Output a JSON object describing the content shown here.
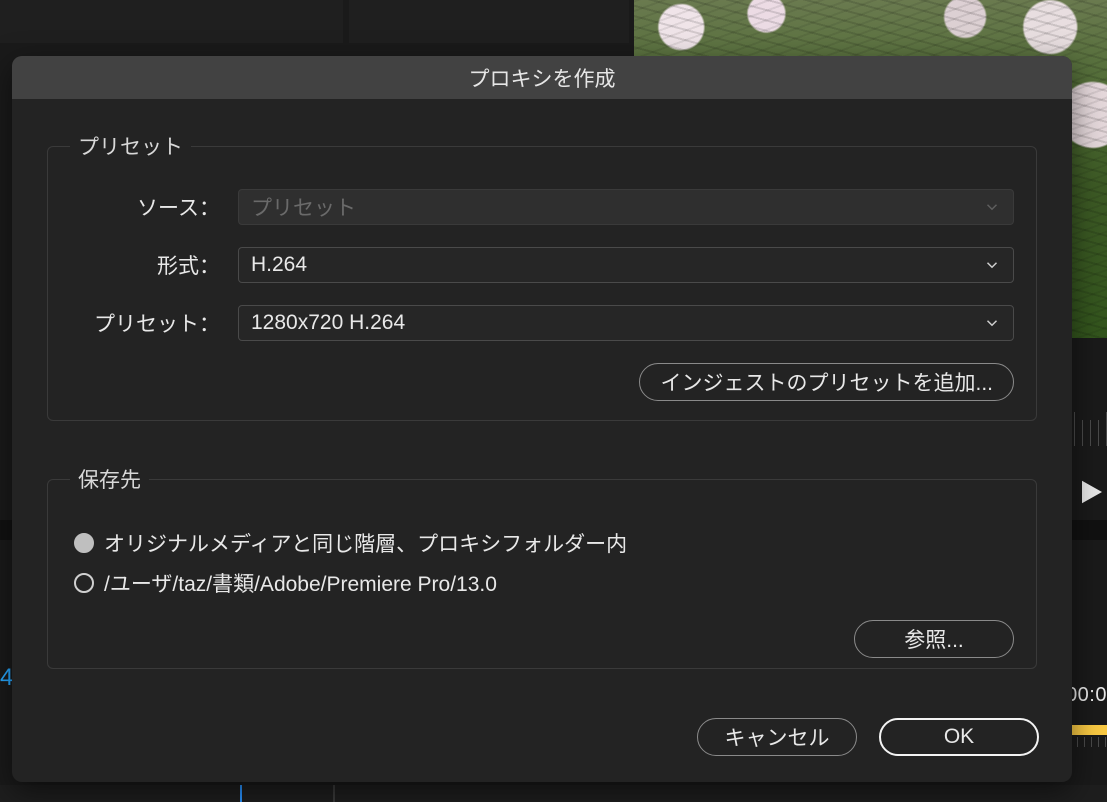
{
  "bg": {
    "clip_label": "4",
    "timecode": "00:0"
  },
  "dialog": {
    "title": "プロキシを作成",
    "preset_group": {
      "legend": "プリセット",
      "source_label": "ソース：",
      "source_value": "プリセット",
      "format_label": "形式：",
      "format_value": "H.264",
      "preset_label": "プリセット：",
      "preset_value": "1280x720 H.264",
      "add_ingest_preset": "インジェストのプリセットを追加..."
    },
    "dest_group": {
      "legend": "保存先",
      "option_same": "オリジナルメディアと同じ階層、プロキシフォルダー内",
      "option_path": "/ユーザ/taz/書類/Adobe/Premiere Pro/13.0",
      "browse": "参照..."
    },
    "footer": {
      "cancel": "キャンセル",
      "ok": "OK"
    }
  }
}
